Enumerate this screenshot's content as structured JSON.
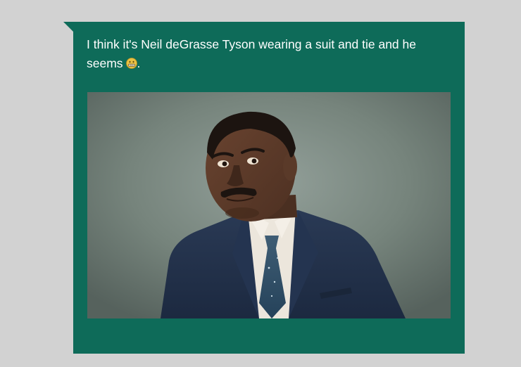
{
  "message": {
    "text": "I think it's Neil deGrasse Tyson wearing a suit and tie and he seems",
    "trailing_punctuation": ".",
    "emoji": "grimacing-face-icon"
  },
  "colors": {
    "background": "#d2d2d2",
    "bubble": "#0e6b59",
    "text": "#ffffff"
  }
}
